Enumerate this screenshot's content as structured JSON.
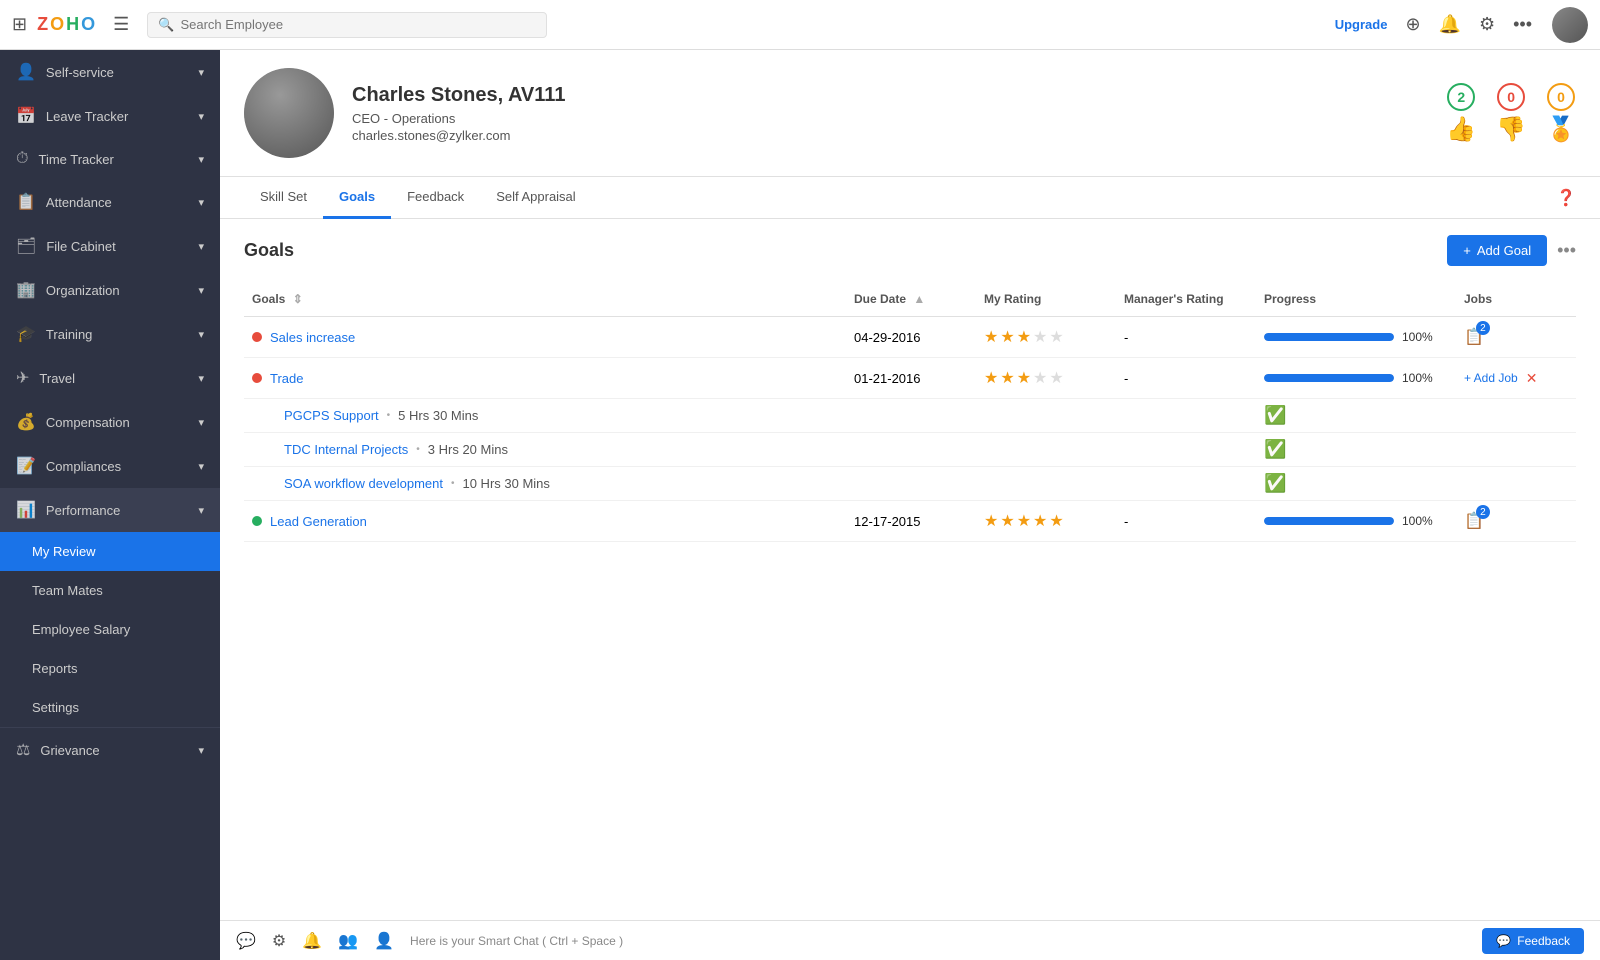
{
  "topbar": {
    "search_placeholder": "Search Employee",
    "upgrade_label": "Upgrade",
    "logo": "ZOHO"
  },
  "sidebar": {
    "items": [
      {
        "id": "self-service",
        "label": "Self-service",
        "icon": "👤",
        "has_arrow": true
      },
      {
        "id": "leave-tracker",
        "label": "Leave Tracker",
        "icon": "📅",
        "has_arrow": true
      },
      {
        "id": "time-tracker",
        "label": "Time Tracker",
        "icon": "⏱",
        "has_arrow": true
      },
      {
        "id": "attendance",
        "label": "Attendance",
        "icon": "📋",
        "has_arrow": true
      },
      {
        "id": "file-cabinet",
        "label": "File Cabinet",
        "icon": "🗂",
        "has_arrow": true
      },
      {
        "id": "organization",
        "label": "Organization",
        "icon": "🏢",
        "has_arrow": true
      },
      {
        "id": "training",
        "label": "Training",
        "icon": "✈",
        "has_arrow": true
      },
      {
        "id": "travel",
        "label": "Travel",
        "icon": "✈",
        "has_arrow": true
      },
      {
        "id": "compensation",
        "label": "Compensation",
        "icon": "💰",
        "has_arrow": true
      },
      {
        "id": "compliances",
        "label": "Compliances",
        "icon": "📝",
        "has_arrow": true
      },
      {
        "id": "performance",
        "label": "Performance",
        "icon": "📊",
        "has_arrow": true,
        "active": true
      }
    ],
    "sub_items": [
      {
        "id": "my-review",
        "label": "My Review",
        "active": true
      },
      {
        "id": "teammates",
        "label": "Team Mates"
      },
      {
        "id": "employee-salary",
        "label": "Employee Salary"
      },
      {
        "id": "reports",
        "label": "Reports"
      },
      {
        "id": "settings",
        "label": "Settings"
      }
    ],
    "bottom_items": [
      {
        "id": "grievance",
        "label": "Grievance",
        "icon": "⚖",
        "has_arrow": true
      }
    ]
  },
  "profile": {
    "name": "Charles Stones, AV111",
    "title": "CEO - Operations",
    "email": "charles.stones@zylker.com",
    "badges": [
      {
        "count": "2",
        "type": "green",
        "icon": "👍"
      },
      {
        "count": "0",
        "type": "red",
        "icon": "👎"
      },
      {
        "count": "0",
        "type": "yellow",
        "icon": "🏅"
      }
    ]
  },
  "tabs": [
    {
      "id": "skill-set",
      "label": "Skill Set"
    },
    {
      "id": "goals",
      "label": "Goals",
      "active": true
    },
    {
      "id": "feedback",
      "label": "Feedback"
    },
    {
      "id": "self-appraisal",
      "label": "Self Appraisal"
    }
  ],
  "goals": {
    "title": "Goals",
    "add_button": "+ Add Goal",
    "columns": [
      "Goals",
      "Due Date",
      "My Rating",
      "Manager's Rating",
      "Progress",
      "Jobs"
    ],
    "rows": [
      {
        "id": "sales-increase",
        "name": "Sales increase",
        "status": "red",
        "due_date": "04-29-2016",
        "my_rating": 3.5,
        "managers_rating": "-",
        "progress": 100,
        "jobs_count": 2,
        "sub_goals": []
      },
      {
        "id": "trade",
        "name": "Trade",
        "status": "red",
        "due_date": "01-21-2016",
        "my_rating": 3.5,
        "managers_rating": "-",
        "progress": 100,
        "jobs_count": 0,
        "show_add_job": true,
        "sub_goals": [
          {
            "name": "PGCPS Support",
            "hours": "5 Hrs 30 Mins",
            "completed": true
          },
          {
            "name": "TDC Internal Projects",
            "hours": "3 Hrs 20 Mins",
            "completed": true
          },
          {
            "name": "SOA workflow development",
            "hours": "10 Hrs 30 Mins",
            "completed": true
          }
        ]
      },
      {
        "id": "lead-generation",
        "name": "Lead Generation",
        "status": "green",
        "due_date": "12-17-2015",
        "my_rating": 5,
        "managers_rating": "-",
        "progress": 100,
        "jobs_count": 2,
        "sub_goals": []
      }
    ]
  },
  "bottom_bar": {
    "smart_chat": "Here is your Smart Chat ( Ctrl + Space )",
    "feedback_label": "Feedback"
  }
}
